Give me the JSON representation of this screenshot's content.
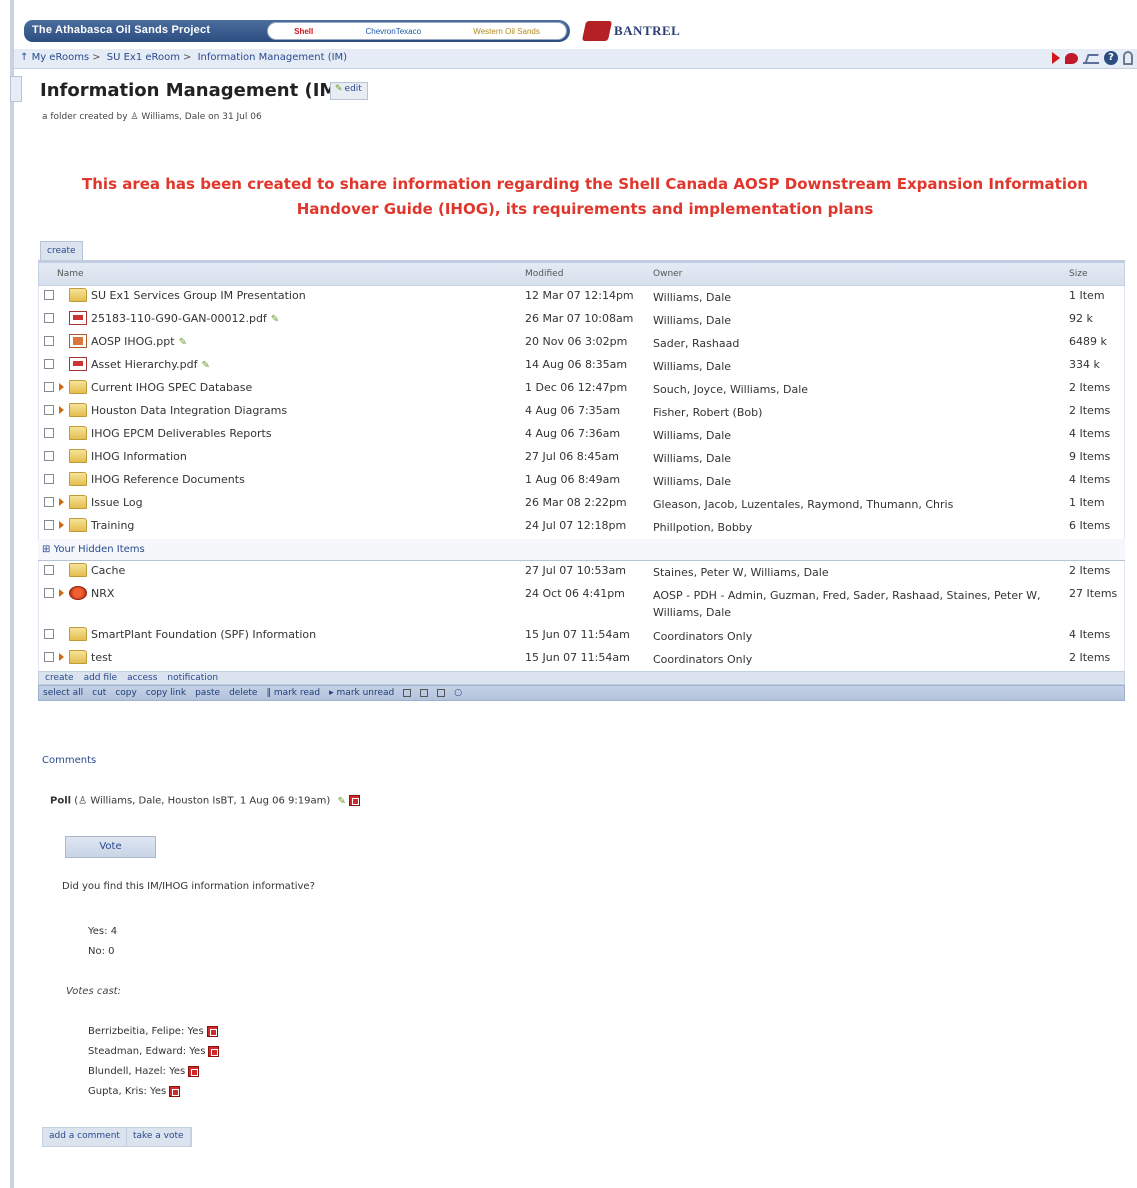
{
  "banner": {
    "title": "The Athabasca Oil Sands Project",
    "sponsors": [
      "Shell",
      "ChevronTexaco",
      "Western Oil Sands"
    ],
    "partner": "BANTREL"
  },
  "breadcrumb": [
    "My eRooms",
    "SU Ex1 eRoom",
    "Information Management (IM)"
  ],
  "header": {
    "title": "Information Management (IM)",
    "edit_label": "edit",
    "created_by": "a folder created by",
    "author": "Williams, Dale",
    "created_on": "on 31 Jul 06"
  },
  "announcement": {
    "line1": "This area has been created to share information regarding the Shell Canada AOSP Downstream Expansion Information",
    "line2": "Handover Guide (IHOG), its requirements and implementation plans"
  },
  "table": {
    "create_tab": "create",
    "columns": {
      "name": "Name",
      "modified": "Modified",
      "owner": "Owner",
      "size": "Size"
    },
    "rows": [
      {
        "name": "SU Ex1 Services Group IM Presentation",
        "modified": "12 Mar 07  12:14pm",
        "owner": "Williams, Dale",
        "size": "1 Item",
        "icon": "folder-icon",
        "expand": false,
        "pen": false
      },
      {
        "name": "25183-110-G90-GAN-00012.pdf",
        "modified": "26 Mar 07  10:08am",
        "owner": "Williams, Dale",
        "size": "92 k",
        "icon": "pdf-icon",
        "expand": false,
        "pen": true
      },
      {
        "name": "AOSP IHOG.ppt",
        "modified": "20 Nov 06  3:02pm",
        "owner": "Sader, Rashaad",
        "size": "6489 k",
        "icon": "ppt-icon",
        "expand": false,
        "pen": true
      },
      {
        "name": "Asset Hierarchy.pdf",
        "modified": "14 Aug 06  8:35am",
        "owner": "Williams, Dale",
        "size": "334 k",
        "icon": "pdf-icon",
        "expand": false,
        "pen": true
      },
      {
        "name": "Current IHOG SPEC Database",
        "modified": "1 Dec 06  12:47pm",
        "owner": "Souch, Joyce, Williams, Dale",
        "size": "2 Items",
        "icon": "folder-icon",
        "expand": true,
        "pen": false
      },
      {
        "name": "Houston Data Integration Diagrams",
        "modified": "4 Aug 06  7:35am",
        "owner": "Fisher, Robert (Bob)",
        "size": "2 Items",
        "icon": "folder-icon",
        "expand": true,
        "pen": false
      },
      {
        "name": "IHOG EPCM Deliverables Reports",
        "modified": "4 Aug 06  7:36am",
        "owner": "Williams, Dale",
        "size": "4 Items",
        "icon": "folder-icon",
        "expand": false,
        "pen": false
      },
      {
        "name": "IHOG Information",
        "modified": "27 Jul 06  8:45am",
        "owner": "Williams, Dale",
        "size": "9 Items",
        "icon": "folder-icon",
        "expand": false,
        "pen": false
      },
      {
        "name": "IHOG Reference Documents",
        "modified": "1 Aug 06  8:49am",
        "owner": "Williams, Dale",
        "size": "4 Items",
        "icon": "folder-icon",
        "expand": false,
        "pen": false
      },
      {
        "name": "Issue Log",
        "modified": "26 Mar 08  2:22pm",
        "owner": "Gleason, Jacob, Luzentales, Raymond, Thumann, Chris",
        "size": "1 Item",
        "icon": "folder-icon",
        "expand": true,
        "pen": false
      },
      {
        "name": "Training",
        "modified": "24 Jul 07  12:18pm",
        "owner": "Phillpotion, Bobby",
        "size": "6 Items",
        "icon": "folder-icon",
        "expand": true,
        "pen": false
      }
    ],
    "hidden_label": "Your Hidden Items",
    "hidden_rows": [
      {
        "name": "Cache",
        "modified": "27 Jul 07  10:53am",
        "owner": "Staines, Peter W, Williams, Dale",
        "size": "2 Items",
        "icon": "folder-icon",
        "expand": false,
        "pen": false,
        "tall": false
      },
      {
        "name": "NRX",
        "modified": "24 Oct 06  4:41pm",
        "owner": "AOSP - PDH - Admin, Guzman, Fred, Sader, Rashaad, Staines, Peter W, Williams, Dale",
        "size": "27 Items",
        "icon": "nrx-icon",
        "expand": true,
        "pen": false,
        "tall": true
      },
      {
        "name": "SmartPlant Foundation (SPF) Information",
        "modified": "15 Jun 07  11:54am",
        "owner": "Coordinators Only",
        "size": "4 Items",
        "icon": "folder-icon",
        "expand": false,
        "pen": false,
        "tall": false
      },
      {
        "name": "test",
        "modified": "15 Jun 07  11:54am",
        "owner": "Coordinators Only",
        "size": "2 Items",
        "icon": "folder-icon",
        "expand": true,
        "pen": false,
        "tall": false
      }
    ],
    "footer_actions": [
      "create",
      "add file",
      "access",
      "notification"
    ],
    "toolbar_actions": [
      "select all",
      "cut",
      "copy",
      "copy link",
      "paste",
      "delete",
      "mark read",
      "mark unread"
    ]
  },
  "comments": {
    "label": "Comments",
    "poll_prefix": "Poll (",
    "poll_author": "Williams, Dale, Houston IsBT, 1 Aug 06  9:19am)",
    "vote_button": "Vote",
    "question": "Did you find this IM/IHOG information informative?",
    "yes": "Yes: 4",
    "no": "No: 0",
    "votes_cast_label": "Votes cast:",
    "voters": [
      "Berrizbeitia, Felipe: Yes",
      "Steadman, Edward: Yes",
      "Blundell, Hazel: Yes",
      "Gupta, Kris: Yes"
    ],
    "add_comment": "add a comment",
    "take_vote": "take a vote"
  }
}
